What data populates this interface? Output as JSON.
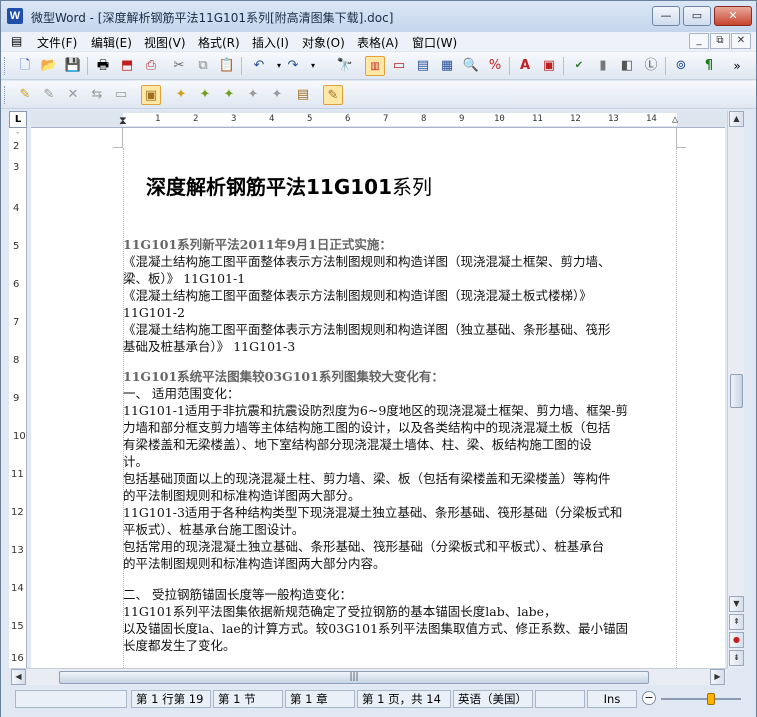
{
  "window": {
    "title": "微型Word - [深度解析钢筋平法11G101系列[附高清图集下载].doc]",
    "app_icon": "W"
  },
  "window_controls": {
    "minimize": "—",
    "maximize": "▭",
    "close": "✕"
  },
  "menu": [
    "文件(F)",
    "编辑(E)",
    "视图(V)",
    "格式(R)",
    "插入(I)",
    "对象(O)",
    "表格(A)",
    "窗口(W)"
  ],
  "mdi_controls": {
    "minimize": "_",
    "restore": "⧉",
    "close": "✕"
  },
  "toolbar1_icons": [
    "new-document-icon",
    "open-folder-icon",
    "save-icon",
    "print-icon",
    "pdf-icon",
    "print-preview-icon",
    "cut-icon",
    "copy-icon",
    "paste-icon",
    "undo-icon",
    "redo-icon",
    "find-icon",
    "page-view-icon",
    "web-view-icon",
    "outline-view-icon",
    "fullscreen-icon",
    "zoom-icon",
    "percent-icon",
    "font-color-icon",
    "insert-field-icon",
    "spellcheck-icon",
    "chart-icon",
    "shapes-icon",
    "text-box-icon",
    "binoculars-icon",
    "paragraph-mark-icon"
  ],
  "toolbar1_more": "»",
  "toolbar2_icons": [
    "revision-icon",
    "edit-revision-icon",
    "delete-revision-icon",
    "compare-icon",
    "show-markup-icon",
    "accept-icon",
    "reject-icon",
    "next-change-icon",
    "previous-change-icon",
    "accept-all-icon",
    "track-changes-icon"
  ],
  "ruler": {
    "corner": "L",
    "h_ticks": [
      "1",
      "2",
      "3",
      "4",
      "5",
      "6",
      "7",
      "8",
      "9",
      "10",
      "11",
      "12",
      "13",
      "14"
    ],
    "v_ticks": [
      "2",
      "3",
      "4",
      "5",
      "6",
      "7",
      "8",
      "9",
      "10",
      "11",
      "12",
      "13",
      "14",
      "15",
      "16"
    ]
  },
  "document": {
    "title_bold": "深度解析钢筋平法11G101",
    "title_rest": "系列",
    "paragraphs": [
      "11G101系列新平法2011年9月1日正式实施：",
      "《混凝土结构施工图平面整体表示方法制图规则和构造详图（现浇混凝土框架、剪力墙、",
      "梁、板）》 11G101-1",
      "《混凝土结构施工图平面整体表示方法制图规则和构造详图（现浇混凝土板式楼梯）》",
      "11G101-2",
      "《混凝土结构施工图平面整体表示方法制图规则和构造详图（独立基础、条形基础、筏形",
      "基础及桩基承台）》 11G101-3",
      "11G101系统平法图集较03G101系列图集较大变化有：",
      "一、 适用范围变化：",
      "11G101-1适用于非抗震和抗震设防烈度为6~9度地区的现浇混凝土框架、剪力墙、框架-剪",
      "力墙和部分框支剪力墙等主体结构施工图的设计，以及各类结构中的现浇混凝土板（包括",
      "有梁楼盖和无梁楼盖）、地下室结构部分现浇混凝土墙体、柱、梁、板结构施工图的设",
      "计。",
      "包括基础顶面以上的现浇混凝土柱、剪力墙、梁、板（包括有梁楼盖和无梁楼盖）等构件",
      "的平法制图规则和标准构造详图两大部分。",
      "11G101-3适用于各种结构类型下现浇混凝土独立基础、条形基础、筏形基础（分梁板式和",
      "平板式）、桩基承台施工图设计。",
      "包括常用的现浇混凝土独立基础、条形基础、筏形基础（分梁板式和平板式）、桩基承台",
      "的平法制图规则和标准构造详图两大部分内容。",
      "二、 受拉钢筋锚固长度等一般构造变化：",
      "11G101系列平法图集依据新规范确定了受拉钢筋的基本锚固长度lab、labe，",
      "以及锚固长度la、lae的计算方式。较03G101系列平法图集取值方式、修正系数、最小锚固",
      "长度都发生了变化。"
    ]
  },
  "scrollbar": {
    "up": "▲",
    "down": "▼",
    "prev_page": "⇞",
    "browse": "●",
    "next_page": "⇟",
    "grip": "|||"
  },
  "status": {
    "line_col": "第 1 行第 19",
    "section": "第 1 节",
    "chapter": "第 1 章",
    "page": "第 1 页，共 14",
    "language": "英语（美国）",
    "mode": "Ins",
    "zoom_minus": "−"
  },
  "colors": {
    "accent": "#1f4fa8",
    "selected": "#ffe7a6"
  }
}
